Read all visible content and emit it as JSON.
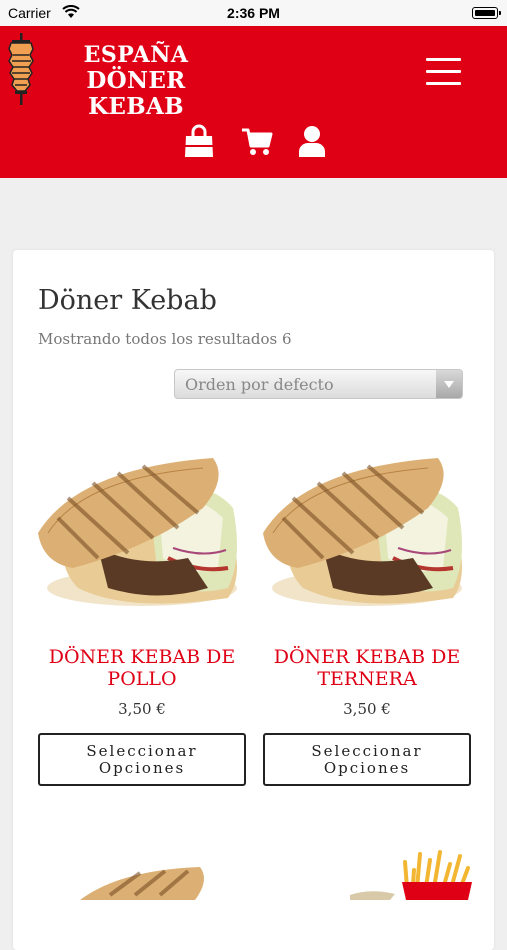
{
  "status_bar": {
    "carrier": "Carrier",
    "time": "2:36 PM"
  },
  "header": {
    "brand_line1": "ESPAÑA",
    "brand_line2": "DÖNER KEBAB",
    "icons": [
      "logo-kebab-icon",
      "menu-icon",
      "shopping-bag-icon",
      "cart-icon",
      "user-icon"
    ]
  },
  "page": {
    "title": "Döner Kebab",
    "result_count": "Mostrando todos los resultados 6",
    "sort_selected": "Orden por defecto"
  },
  "products": [
    {
      "name": "DÖNER KEBAB DE POLLO",
      "price": "3,50 €",
      "button": "Seleccionar Opciones"
    },
    {
      "name": "DÖNER KEBAB DE TERNERA",
      "price": "3,50 €",
      "button": "Seleccionar Opciones"
    }
  ],
  "colors": {
    "brand_red": "#e00016",
    "background": "#efefef",
    "card": "#ffffff"
  }
}
